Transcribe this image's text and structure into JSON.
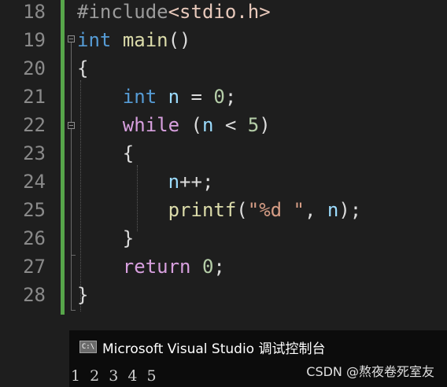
{
  "editor": {
    "line_numbers": [
      "18",
      "19",
      "20",
      "21",
      "22",
      "23",
      "24",
      "25",
      "26",
      "27",
      "28"
    ],
    "code": {
      "l18_directive": "#include",
      "l18_header": "<stdio.h>",
      "l19_type": "int",
      "l19_func": "main",
      "l19_parens": "()",
      "l20_brace": "{",
      "l21_type": "int",
      "l21_var": "n",
      "l21_assign": " = ",
      "l21_num": "0",
      "l21_semi": ";",
      "l22_kw": "while",
      "l22_open": " (",
      "l22_var": "n",
      "l22_op": " < ",
      "l22_num": "5",
      "l22_close": ")",
      "l23_brace": "{",
      "l24_var": "n",
      "l24_rest": "++;",
      "l25_func": "printf",
      "l25_open": "(",
      "l25_str": "\"%d \"",
      "l25_comma": ", ",
      "l25_var": "n",
      "l25_close": ");",
      "l26_brace": "}",
      "l27_kw": "return",
      "l27_space": " ",
      "l27_num": "0",
      "l27_semi": ";",
      "l28_brace": "}"
    },
    "colors": {
      "keyword": "#569cd6",
      "control": "#d8a0df",
      "function": "#dcdcaa",
      "string": "#d69d85",
      "variable": "#9cdcfe",
      "number": "#b5cea8",
      "change_bar": "#57a64a"
    }
  },
  "console": {
    "icon_text": "C:\\",
    "title": "Microsoft Visual Studio 调试控制台",
    "output": "1 2 3 4 5"
  },
  "watermark": "CSDN @熬夜卷死室友"
}
